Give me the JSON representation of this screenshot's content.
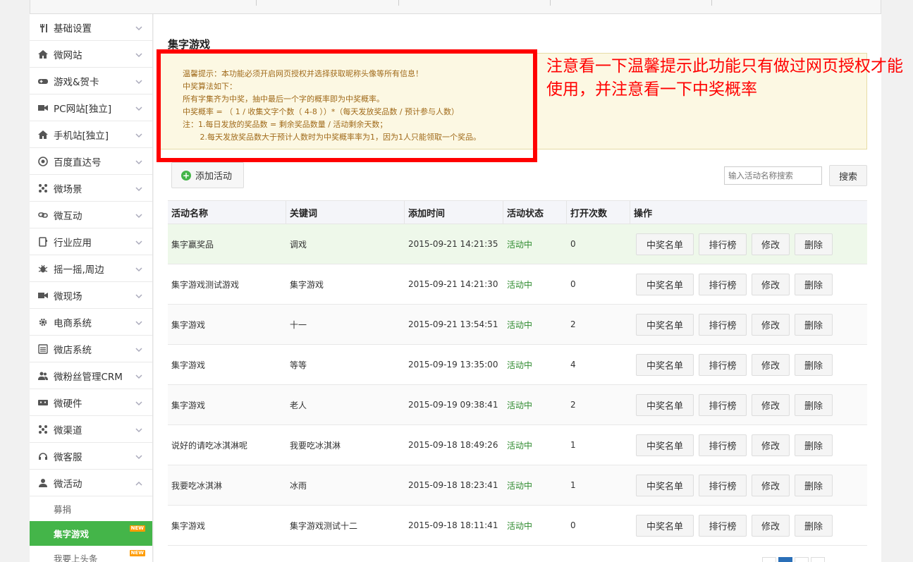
{
  "sidebar": {
    "items": [
      {
        "label": "基础设置",
        "icon": "tools-icon"
      },
      {
        "label": "微网站",
        "icon": "home-icon"
      },
      {
        "label": "游戏&贺卡",
        "icon": "gamepad-icon"
      },
      {
        "label": "PC网站[独立]",
        "icon": "video-camera-icon"
      },
      {
        "label": "手机站[独立]",
        "icon": "home-icon"
      },
      {
        "label": "百度直达号",
        "icon": "target-icon"
      },
      {
        "label": "微场景",
        "icon": "grid-icon"
      },
      {
        "label": "微互动",
        "icon": "link-icon"
      },
      {
        "label": "行业应用",
        "icon": "tablet-icon"
      },
      {
        "label": "摇一摇,周边",
        "icon": "bug-icon"
      },
      {
        "label": "微现场",
        "icon": "video-camera-icon"
      },
      {
        "label": "电商系统",
        "icon": "gear-icon"
      },
      {
        "label": "微店系统",
        "icon": "list-box-icon"
      },
      {
        "label": "微粉丝管理CRM",
        "icon": "users-icon"
      },
      {
        "label": "微硬件",
        "icon": "usb-icon"
      },
      {
        "label": "微渠道",
        "icon": "grid-icon"
      },
      {
        "label": "微客服",
        "icon": "headset-icon"
      },
      {
        "label": "微活动",
        "icon": "user-icon"
      }
    ],
    "sub_items": [
      {
        "label": "募捐"
      },
      {
        "label": "集字游戏",
        "badge": "NEW"
      },
      {
        "label": "我要上头条",
        "badge": "NEW"
      }
    ]
  },
  "main": {
    "title": "集字游戏",
    "tips": [
      "温馨提示：本功能必须开启网页授权并选择获取昵称头像等所有信息！",
      "中奖算法如下：",
      "所有字集齐为中奖，抽中最后一个字的概率即为中奖概率。",
      "中奖概率 = （ 1 / 收集文字个数（ 4-8 ））*（每天发放奖品数 / 预计参与人数）",
      "注：1.每日发放的奖品数 = 剩余奖品数量 / 活动剩余天数；",
      "       2.每天发放奖品数大于预计人数时为中奖概率率为1，因为1人只能领取一个奖品。"
    ],
    "annotation": "注意看一下温馨提示此功能只有做过网页授权才能使用，并注意看一下中奖概率",
    "add_button": "添加活动",
    "search_placeholder": "输入活动名称搜索",
    "search_button": "搜索",
    "table": {
      "headers": [
        "活动名称",
        "关键词",
        "添加时间",
        "活动状态",
        "打开次数",
        "操作"
      ],
      "rows": [
        {
          "name": "集字赢奖品",
          "keyword": "调戏",
          "time": "2015-09-21 14:21:35",
          "status": "活动中",
          "opens": "0"
        },
        {
          "name": "集字游戏测试游戏",
          "keyword": "集字游戏",
          "time": "2015-09-21 14:21:30",
          "status": "活动中",
          "opens": "0"
        },
        {
          "name": "集字游戏",
          "keyword": "十一",
          "time": "2015-09-21 13:54:51",
          "status": "活动中",
          "opens": "2"
        },
        {
          "name": "集字游戏",
          "keyword": "等等",
          "time": "2015-09-19 13:35:00",
          "status": "活动中",
          "opens": "4"
        },
        {
          "name": "集字游戏",
          "keyword": "老人",
          "time": "2015-09-19 09:38:41",
          "status": "活动中",
          "opens": "2"
        },
        {
          "name": "说好的请吃冰淇淋呢",
          "keyword": "我要吃冰淇淋",
          "time": "2015-09-18 18:49:26",
          "status": "活动中",
          "opens": "1"
        },
        {
          "name": "我要吃冰淇淋",
          "keyword": "冰雨",
          "time": "2015-09-18 18:23:41",
          "status": "活动中",
          "opens": "1"
        },
        {
          "name": "集字游戏",
          "keyword": "集字游戏测试十二",
          "time": "2015-09-18 18:11:41",
          "status": "活动中",
          "opens": "0"
        }
      ],
      "actions": [
        "中奖名单",
        "排行榜",
        "修改",
        "删除"
      ]
    }
  },
  "colors": {
    "accent": "#44b549",
    "annotation": "#ff0000",
    "status": "#2e8b2e",
    "tips_bg": "#fcf8e3"
  }
}
